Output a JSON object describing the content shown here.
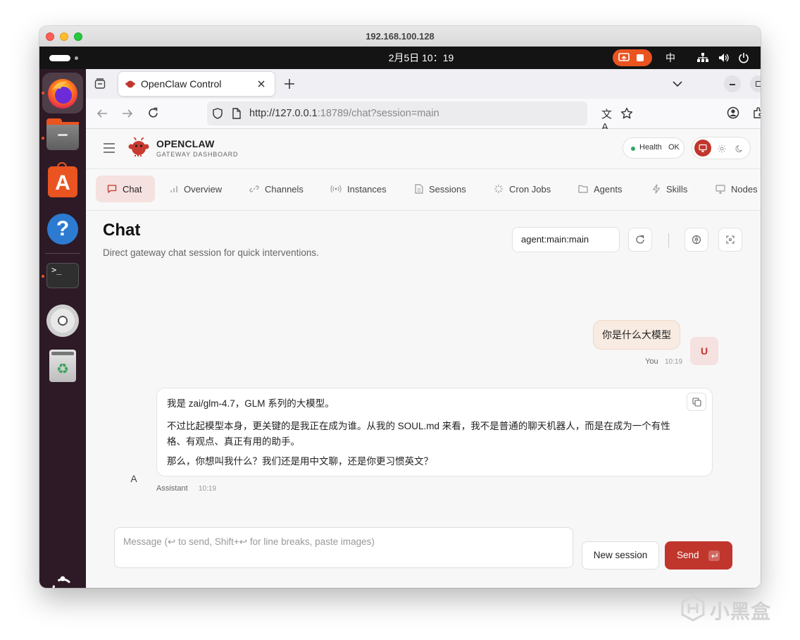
{
  "window": {
    "title": "192.168.100.128"
  },
  "topbar": {
    "clock": "2月5日  10：19",
    "input_method": "中"
  },
  "dock": {
    "apps": [
      "firefox",
      "files",
      "app-center",
      "help",
      "terminal",
      "disc",
      "trash",
      "show-apps"
    ]
  },
  "browser": {
    "tab_title": "OpenClaw Control",
    "url_host": "http://127.0.0.1",
    "url_rest": ":18789/chat?session=main"
  },
  "app": {
    "brand": "OPENCLAW",
    "brand_sub": "GATEWAY DASHBOARD",
    "health_label": "Health",
    "health_status": "OK",
    "nav_tabs": [
      {
        "label": "Chat"
      },
      {
        "label": "Overview"
      },
      {
        "label": "Channels"
      },
      {
        "label": "Instances"
      },
      {
        "label": "Sessions"
      },
      {
        "label": "Cron Jobs"
      },
      {
        "label": "Agents"
      },
      {
        "label": "Skills"
      },
      {
        "label": "Nodes"
      }
    ]
  },
  "chat": {
    "title": "Chat",
    "subtitle": "Direct gateway chat session for quick interventions.",
    "session_value": "agent:main:main",
    "messages": [
      {
        "role": "user",
        "avatar": "U",
        "text": "你是什么大模型",
        "sender": "You",
        "time": "10:19"
      },
      {
        "role": "assistant",
        "avatar": "A",
        "sender": "Assistant",
        "time": "10:19",
        "paragraphs": [
          "我是 zai/glm-4.7，GLM 系列的大模型。",
          "不过比起模型本身，更关键的是我正在成为谁。从我的 SOUL.md 来看，我不是普通的聊天机器人，而是在成为一个有性格、有观点、真正有用的助手。",
          "那么，你想叫我什么？我们还是用中文聊，还是你更习惯英文？"
        ]
      }
    ],
    "composer_placeholder": "Message (↩ to send, Shift+↩ for line breaks, paste images)",
    "new_session_label": "New session",
    "send_label": "Send"
  },
  "watermark": {
    "text": "小黑盒"
  },
  "colors": {
    "accent": "#c0362c",
    "accent_soft": "#f6e3e1",
    "user_bubble": "#f8ebe1"
  }
}
